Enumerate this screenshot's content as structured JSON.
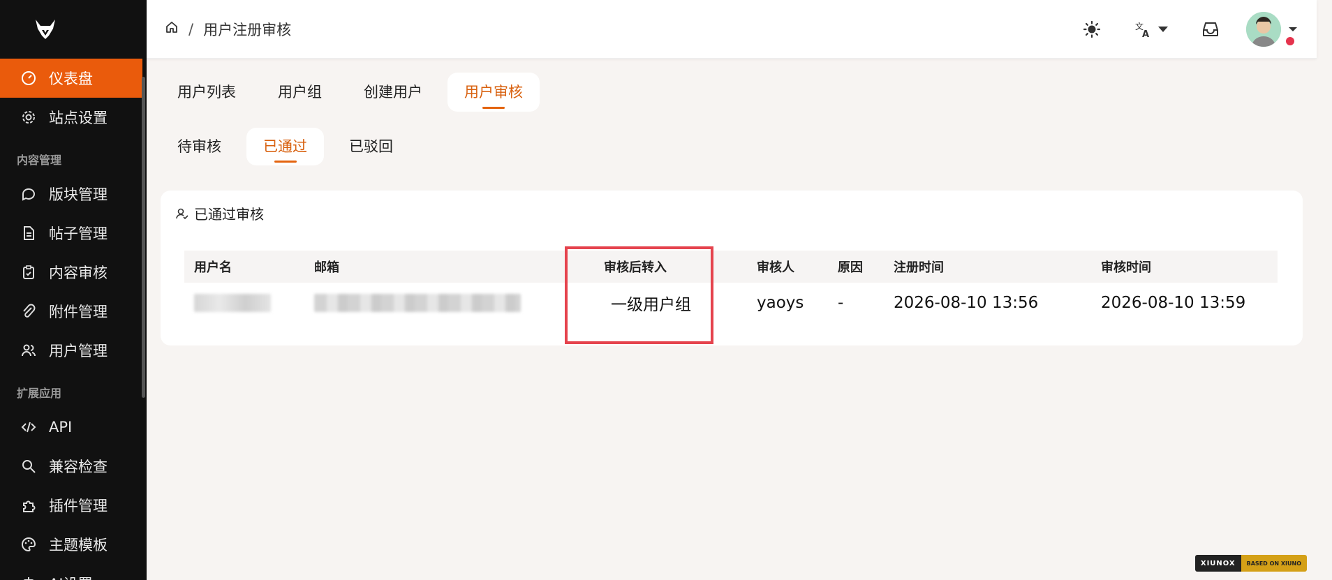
{
  "breadcrumb": {
    "current": "用户注册审核",
    "separator": "/"
  },
  "sidebar": {
    "items": [
      {
        "label": "仪表盘",
        "icon": "dashboard-icon",
        "active": true
      },
      {
        "label": "站点设置",
        "icon": "gear-icon"
      }
    ],
    "sections": [
      {
        "title": "内容管理",
        "items": [
          {
            "label": "版块管理",
            "icon": "chat-bubble-icon"
          },
          {
            "label": "帖子管理",
            "icon": "document-icon"
          },
          {
            "label": "内容审核",
            "icon": "clipboard-check-icon"
          },
          {
            "label": "附件管理",
            "icon": "paperclip-icon"
          },
          {
            "label": "用户管理",
            "icon": "users-icon"
          }
        ]
      },
      {
        "title": "扩展应用",
        "items": [
          {
            "label": "API",
            "icon": "code-icon"
          },
          {
            "label": "兼容检查",
            "icon": "search-icon"
          },
          {
            "label": "插件管理",
            "icon": "puzzle-icon"
          },
          {
            "label": "主题模板",
            "icon": "palette-icon"
          },
          {
            "label": "AI设置",
            "icon": "ai-icon"
          }
        ]
      }
    ]
  },
  "tabs": [
    {
      "label": "用户列表"
    },
    {
      "label": "用户组"
    },
    {
      "label": "创建用户"
    },
    {
      "label": "用户审核",
      "active": true
    }
  ],
  "subtabs": [
    {
      "label": "待审核"
    },
    {
      "label": "已通过",
      "active": true
    },
    {
      "label": "已驳回"
    }
  ],
  "card": {
    "title": "已通过审核",
    "columns": {
      "username": "用户名",
      "email": "邮箱",
      "move_to": "审核后转入",
      "reviewer": "审核人",
      "reason": "原因",
      "registered_at": "注册时间",
      "reviewed_at": "审核时间"
    },
    "rows": [
      {
        "move_to": "一级用户组",
        "reviewer": "yaoys",
        "reason": "-",
        "registered_at": "2026-08-10 13:56",
        "reviewed_at": "2026-08-10 13:59"
      }
    ]
  },
  "footer_badge": {
    "left": "XIUNOX",
    "right": "BASED ON XIUNO"
  },
  "colors": {
    "accent": "#ea5b0c",
    "highlight": "#e5434d",
    "sidebar_bg": "#111111"
  }
}
